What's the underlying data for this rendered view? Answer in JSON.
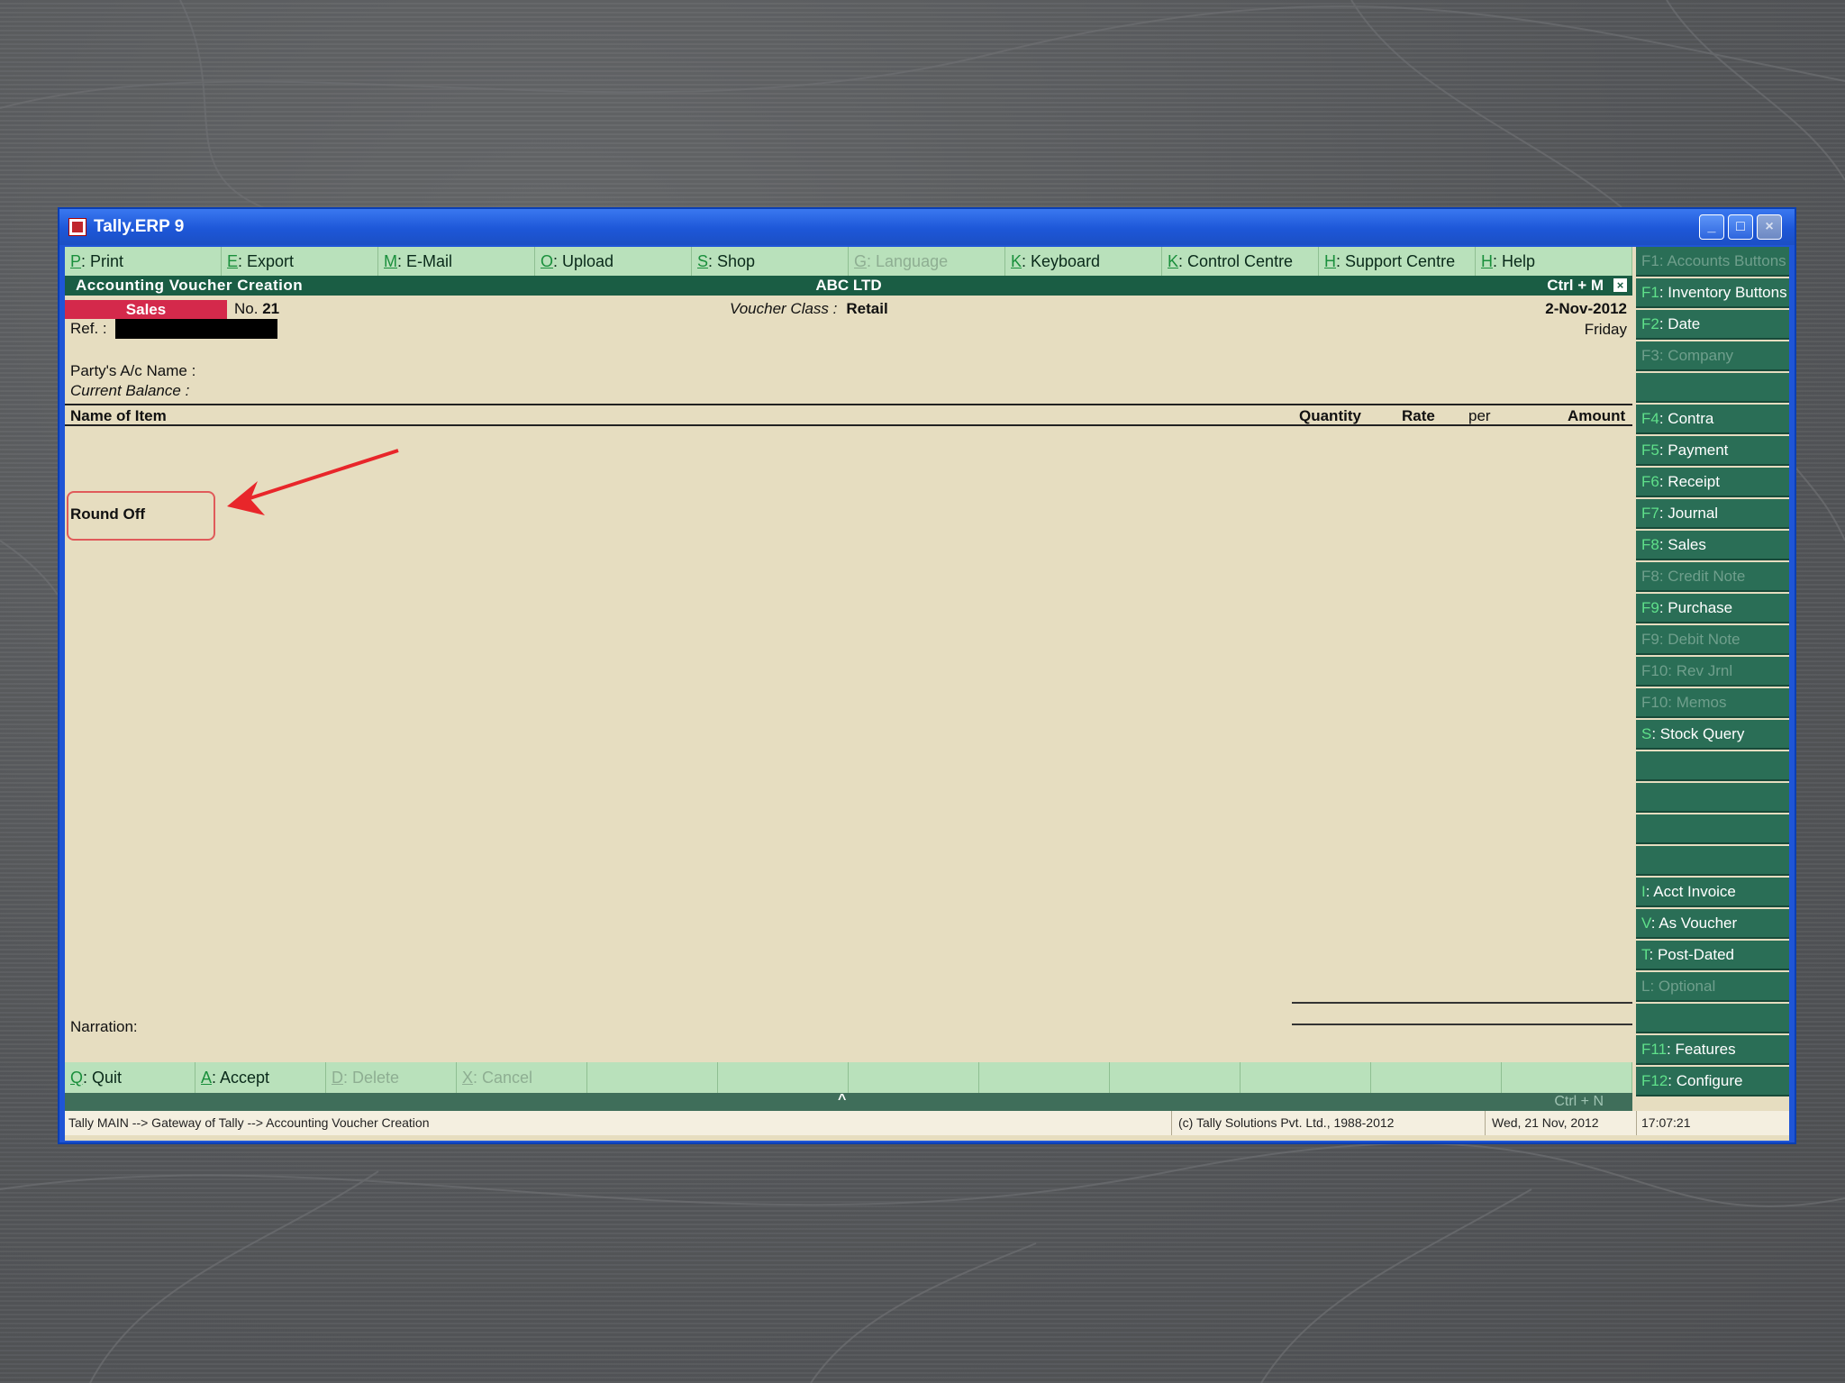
{
  "window": {
    "title": "Tally.ERP 9",
    "minimize": "_",
    "maximize": "□",
    "close": "×"
  },
  "top_menu": [
    {
      "key": "P",
      "label": ": Print",
      "disabled": false
    },
    {
      "key": "E",
      "label": ": Export",
      "disabled": false
    },
    {
      "key": "M",
      "label": ": E-Mail",
      "disabled": false
    },
    {
      "key": "O",
      "label": ": Upload",
      "disabled": false
    },
    {
      "key": "S",
      "label": ": Shop",
      "disabled": false
    },
    {
      "key": "G",
      "label": ": Language",
      "disabled": true
    },
    {
      "key": "K",
      "label": ": Keyboard",
      "disabled": false
    },
    {
      "key": "K",
      "label": ": Control Centre",
      "disabled": false
    },
    {
      "key": "H",
      "label": ": Support Centre",
      "disabled": false
    },
    {
      "key": "H",
      "label": ": Help",
      "disabled": false
    }
  ],
  "header": {
    "screen": "Accounting Voucher  Creation",
    "company": "ABC LTD",
    "shortcut": "Ctrl + M",
    "close": "×"
  },
  "voucher": {
    "type": "Sales",
    "no_label": "No.",
    "no": "21",
    "ref_label": "Ref. :",
    "class_label": "Voucher Class :",
    "class_value": "Retail",
    "date": "2-Nov-2012",
    "day": "Friday",
    "party_label": "Party's A/c Name   :",
    "balance_label": "Current Balance      :",
    "columns": {
      "item": "Name of Item",
      "quantity": "Quantity",
      "rate": "Rate",
      "per": "per",
      "amount": "Amount"
    },
    "round_off": "Round Off",
    "narration_label": "Narration:"
  },
  "bottom_buttons": [
    {
      "key": "Q",
      "label": ": Quit",
      "disabled": false
    },
    {
      "key": "A",
      "label": ": Accept",
      "disabled": false
    },
    {
      "key": "D",
      "label": ": Delete",
      "disabled": true
    },
    {
      "key": "X",
      "label": ": Cancel",
      "disabled": true
    },
    {
      "key": "",
      "label": "",
      "disabled": false
    },
    {
      "key": "",
      "label": "",
      "disabled": false
    },
    {
      "key": "",
      "label": "",
      "disabled": false
    },
    {
      "key": "",
      "label": "",
      "disabled": false
    },
    {
      "key": "",
      "label": "",
      "disabled": false
    },
    {
      "key": "",
      "label": "",
      "disabled": false
    },
    {
      "key": "",
      "label": "",
      "disabled": false
    },
    {
      "key": "",
      "label": "",
      "disabled": false
    }
  ],
  "bottom_bar": {
    "caret": "^",
    "shortcut": "Ctrl + N"
  },
  "right_panel": [
    {
      "key": "F1",
      "label": ": Accounts Buttons",
      "disabled": true
    },
    {
      "key": "F1",
      "label": ": Inventory Buttons",
      "disabled": false
    },
    {
      "key": "F2",
      "label": ": Date",
      "disabled": false
    },
    {
      "key": "F3",
      "label": ": Company",
      "disabled": true
    },
    {
      "key": "",
      "label": "",
      "disabled": false
    },
    {
      "key": "F4",
      "label": ": Contra",
      "disabled": false
    },
    {
      "key": "F5",
      "label": ": Payment",
      "disabled": false
    },
    {
      "key": "F6",
      "label": ": Receipt",
      "disabled": false
    },
    {
      "key": "F7",
      "label": ": Journal",
      "disabled": false
    },
    {
      "key": "F8",
      "label": ": Sales",
      "disabled": false
    },
    {
      "key": "F8",
      "label": ": Credit Note",
      "disabled": true
    },
    {
      "key": "F9",
      "label": ": Purchase",
      "disabled": false
    },
    {
      "key": "F9",
      "label": ": Debit Note",
      "disabled": true
    },
    {
      "key": "F10",
      "label": ": Rev Jrnl",
      "disabled": true
    },
    {
      "key": "F10",
      "label": ": Memos",
      "disabled": true
    },
    {
      "key": "S",
      "label": ": Stock Query",
      "disabled": false
    },
    {
      "key": "",
      "label": "",
      "disabled": false
    },
    {
      "key": "",
      "label": "",
      "disabled": false
    },
    {
      "key": "",
      "label": "",
      "disabled": false
    },
    {
      "key": "",
      "label": "",
      "disabled": false
    },
    {
      "key": "I",
      "label": ": Acct Invoice",
      "disabled": false
    },
    {
      "key": "V",
      "label": ": As Voucher",
      "disabled": false
    },
    {
      "key": "T",
      "label": ": Post-Dated",
      "disabled": false
    },
    {
      "key": "L",
      "label": ": Optional",
      "disabled": true
    },
    {
      "key": "",
      "label": "",
      "disabled": false
    },
    {
      "key": "F11",
      "label": ": Features",
      "disabled": false
    },
    {
      "key": "F12",
      "label": ": Configure",
      "disabled": false
    }
  ],
  "status_bar": {
    "path": "Tally MAIN --> Gateway of Tally --> Accounting Voucher  Creation",
    "copyright": "(c) Tally Solutions Pvt. Ltd., 1988-2012",
    "date": "Wed, 21 Nov, 2012",
    "time": "17:07:21"
  },
  "colors": {
    "accent_green": "#1a5d44",
    "menu_green": "#b9e1bb",
    "voucher_red": "#d4294b",
    "highlight_red": "#e05a5a"
  }
}
